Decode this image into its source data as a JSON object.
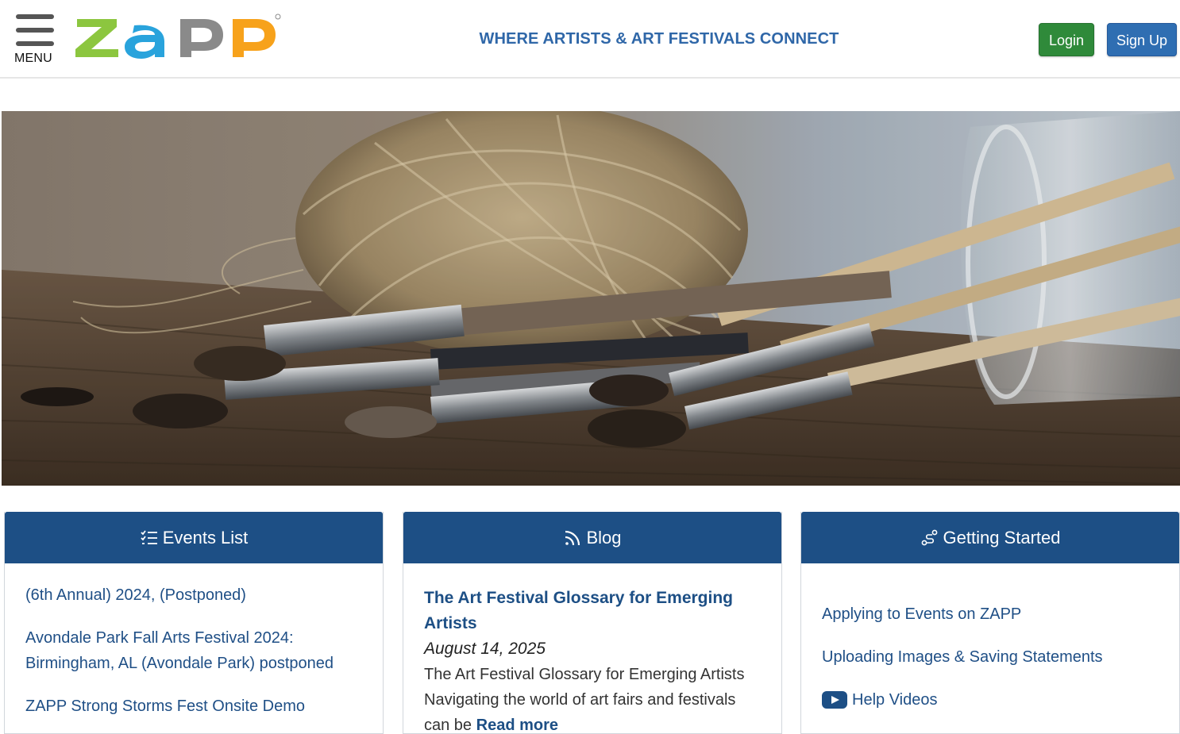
{
  "header": {
    "menu_label": "MENU",
    "logo_text": "ZAPP",
    "tagline": "WHERE ARTISTS & ART FESTIVALS CONNECT",
    "login_label": "Login",
    "signup_label": "Sign Up"
  },
  "hero": {
    "image": "paintbrushes-twine-jar-photo"
  },
  "cards": {
    "events": {
      "title": "Events List",
      "icon": "list-check-icon",
      "items": [
        "(6th Annual) 2024, (Postponed)",
        "Avondale Park Fall Arts Festival 2024: Birmingham, AL (Avondale Park) postponed",
        "ZAPP Strong Storms Fest Onsite Demo"
      ]
    },
    "blog": {
      "title": "Blog",
      "icon": "rss-icon",
      "post_title": "The Art Festival Glossary for Emerging Artists",
      "post_date": "August 14, 2025",
      "post_excerpt": "The Art Festival Glossary for Emerging Artists Navigating the world of art fairs and festivals can be",
      "read_more": "Read more"
    },
    "getting_started": {
      "title": "Getting Started",
      "icon": "route-icon",
      "items": [
        "Applying to Events on ZAPP",
        "Uploading Images & Saving Statements",
        "Help Videos"
      ],
      "video_icon": "youtube-play-icon"
    }
  },
  "colors": {
    "header_blue": "#1d4f85",
    "tagline_blue": "#2f67a8",
    "login_green": "#2f8a3a",
    "signup_blue": "#2f6eb2",
    "logo_green": "#8cc63f",
    "logo_blue": "#29a3dc",
    "logo_gray": "#8a8a8a",
    "logo_orange": "#f7a21b"
  }
}
